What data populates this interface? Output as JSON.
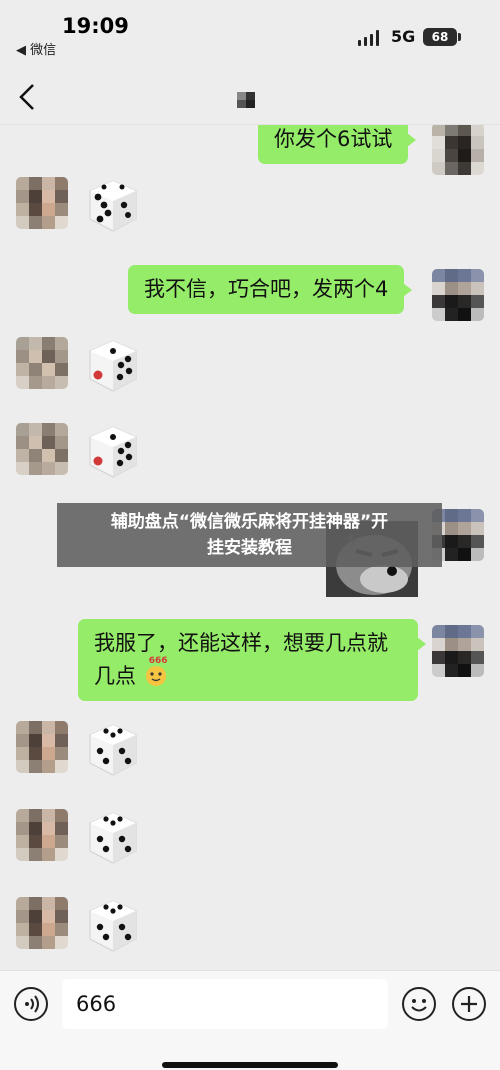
{
  "status_bar": {
    "time": "19:09",
    "back_app": "◀ 微信",
    "network": "5G",
    "battery": "68"
  },
  "chat": {
    "messages": [
      {
        "type": "text",
        "side": "right",
        "text": "你发个6试试"
      },
      {
        "type": "dice",
        "side": "left",
        "face": 5
      },
      {
        "type": "text",
        "side": "right",
        "text": "我不信，巧合吧，发两个4"
      },
      {
        "type": "dice",
        "side": "left",
        "face": 5
      },
      {
        "type": "dice",
        "side": "left",
        "face": 5
      },
      {
        "type": "sticker",
        "side": "right"
      },
      {
        "type": "text",
        "side": "right",
        "text": "我服了，还能这样，想要几点就几点",
        "line1": "我服了，还能这样，想要几点就",
        "line2": "几点",
        "emoji_label": "666"
      },
      {
        "type": "dice",
        "side": "left",
        "face": 5
      },
      {
        "type": "dice",
        "side": "left",
        "face": 5
      },
      {
        "type": "dice",
        "side": "left",
        "face": 5
      }
    ]
  },
  "overlay": {
    "line1": "辅助盘点“微信微乐麻将开挂神器”开",
    "line2": "挂安装教程"
  },
  "input_bar": {
    "value": "666"
  },
  "icons": {
    "back": "chevron-left-icon",
    "voice": "voice-icon",
    "emoji": "emoji-icon",
    "plus": "plus-icon"
  },
  "colors": {
    "bubble": "#95ec69",
    "background": "#ededed",
    "overlay": "#5f5f5f"
  }
}
